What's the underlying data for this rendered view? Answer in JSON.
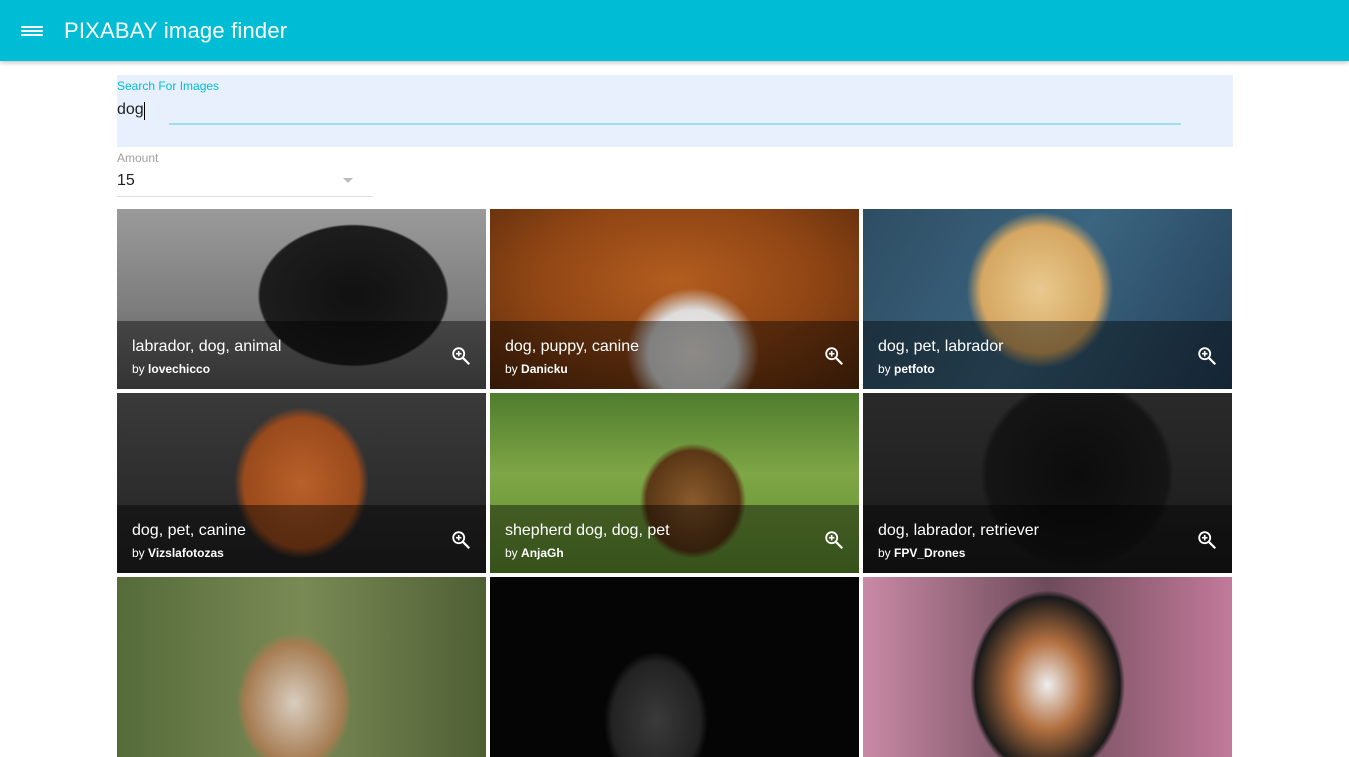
{
  "appbar": {
    "title": "PIXABAY image finder",
    "menu_icon": "menu-icon",
    "color": "#00bcd4"
  },
  "search": {
    "label": "Search For Images",
    "value": "dog"
  },
  "amount": {
    "label": "Amount",
    "value": "15"
  },
  "images": [
    {
      "title": "labrador, dog, animal",
      "by": "by",
      "user": "lovechicco"
    },
    {
      "title": "dog, puppy, canine",
      "by": "by",
      "user": "Danicku"
    },
    {
      "title": "dog, pet, labrador",
      "by": "by",
      "user": "petfoto"
    },
    {
      "title": "dog, pet, canine",
      "by": "by",
      "user": "Vizslafotozas"
    },
    {
      "title": "shepherd dog, dog, pet",
      "by": "by",
      "user": "AnjaGh"
    },
    {
      "title": "dog, labrador, retriever",
      "by": "by",
      "user": "FPV_Drones"
    },
    {
      "title": "",
      "by": "",
      "user": ""
    },
    {
      "title": "",
      "by": "",
      "user": ""
    },
    {
      "title": "",
      "by": "",
      "user": ""
    }
  ],
  "zoom_icon": "zoom-in-icon"
}
